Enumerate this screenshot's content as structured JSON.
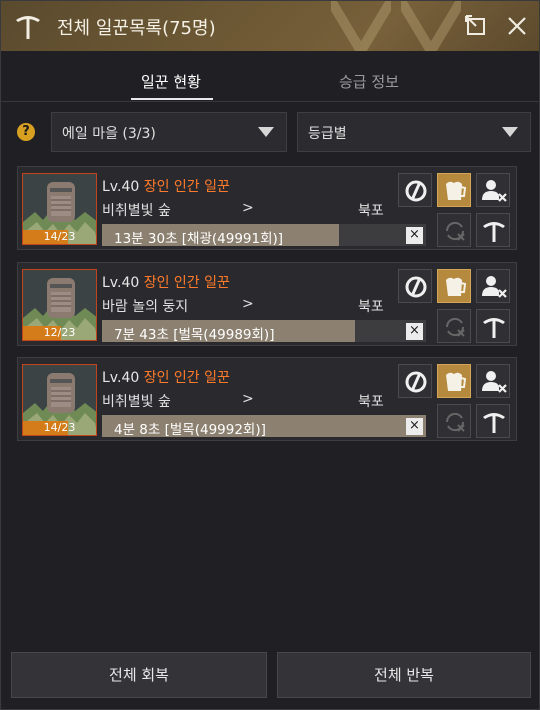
{
  "window": {
    "title": "전체 일꾼목록(75명)"
  },
  "tabs": [
    {
      "label": "일꾼 현황",
      "active": true
    },
    {
      "label": "승급 정보",
      "active": false
    }
  ],
  "filters": {
    "help_label": "?",
    "village": "에일 마을 (3/3)",
    "sort": "등급별"
  },
  "workers": [
    {
      "level": "Lv.40",
      "name": "장인 인간 일꾼",
      "location": "비취별빛 숲",
      "arrow": ">",
      "destination": "북포",
      "stamina": "14/23",
      "stamina_fraction": 0.61,
      "task": "13분 30초 [채광(49991회)]",
      "progress": 0.73,
      "close_label": "×"
    },
    {
      "level": "Lv.40",
      "name": "장인 인간 일꾼",
      "location": "바람 놀의 둥지",
      "arrow": ">",
      "destination": "북포",
      "stamina": "12/23",
      "stamina_fraction": 0.52,
      "task": "7분 43초 [벌목(49989회)]",
      "progress": 0.78,
      "close_label": "×"
    },
    {
      "level": "Lv.40",
      "name": "장인 인간 일꾼",
      "location": "비취별빛 숲",
      "arrow": ">",
      "destination": "북포",
      "stamina": "14/23",
      "stamina_fraction": 0.61,
      "task": "4분 8초 [벌목(49992회)]",
      "progress": 1.0,
      "close_label": "×"
    }
  ],
  "footer": {
    "recover_all": "전체 회복",
    "repeat_all": "전체 반복"
  },
  "colors": {
    "title_bg": "#6b5733",
    "worker_name": "#ff7a2a",
    "stamina_bar": "#d47c1a",
    "progress_fill": "#8c8170",
    "active_action": "#b58a3e",
    "help_icon": "#d8a020"
  }
}
